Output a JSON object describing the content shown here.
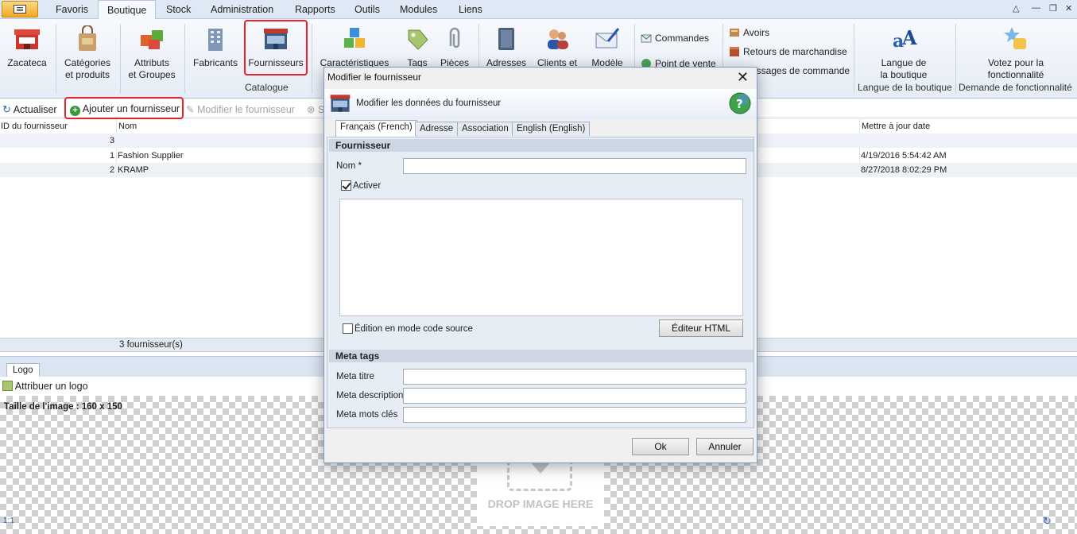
{
  "menu": {
    "tabs": [
      "Favoris",
      "Boutique",
      "Stock",
      "Administration",
      "Rapports",
      "Outils",
      "Modules",
      "Liens"
    ],
    "active_tab": "Boutique"
  },
  "ribbon": {
    "zacateca": "Zacateca",
    "categories_l1": "Catégories",
    "categories_l2": "et produits",
    "attributs_l1": "Attributs",
    "attributs_l2": "et Groupes",
    "fabricants": "Fabricants",
    "fournisseurs": "Fournisseurs",
    "catalogue_group": "Catalogue",
    "caracteristiques": "Caractéristiques",
    "tags": "Tags",
    "pieces": "Pièces",
    "adresses": "Adresses",
    "clients": "Clients et",
    "modele": "Modèle",
    "commandes": "Commandes",
    "point_de_vente": "Point de vente",
    "avoirs": "Avoirs",
    "retours": "Retours de marchandise",
    "messages": "Messages de commande",
    "langue_l1": "Langue de",
    "langue_l2": "la boutique",
    "langue_group": "Langue de la boutique",
    "votez_l1": "Votez pour la",
    "votez_l2": "fonctionnalité",
    "demande_group": "Demande de fonctionnalité"
  },
  "toolbar": {
    "refresh": "Actualiser",
    "add": "Ajouter un fournisseur",
    "edit": "Modifier le fournisseur",
    "delete_partial": "S"
  },
  "grid": {
    "columns": [
      "ID du fournisseur",
      "Nom",
      "Mettre à jour date"
    ],
    "rows": [
      {
        "id": "3",
        "name": "",
        "date": ""
      },
      {
        "id": "1",
        "name": "Fashion Supplier",
        "date": "4/19/2016 5:54:42 AM"
      },
      {
        "id": "2",
        "name": "KRAMP",
        "date": "8/27/2018 8:02:29 PM"
      }
    ],
    "footer": "3 fournisseur(s)"
  },
  "logo": {
    "tab": "Logo",
    "assign": "Attribuer un logo",
    "size": "Taille de l'image : 160 x 150",
    "drop": "DROP IMAGE HERE"
  },
  "dialog": {
    "title": "Modifier le fournisseur",
    "subtitle": "Modifier les données du fournisseur",
    "tabs": [
      "Français (French)",
      "Adresse",
      "Association",
      "English (English)"
    ],
    "section_supplier": "Fournisseur",
    "name_label": "Nom *",
    "name_value": "",
    "active_label": "Activer",
    "active_checked": true,
    "source_label": "Édition en mode code source",
    "html_editor": "Éditeur HTML",
    "section_meta": "Meta tags",
    "meta_title": "Meta titre",
    "meta_description": "Meta description",
    "meta_keywords": "Meta mots clés",
    "ok": "Ok",
    "cancel": "Annuler"
  },
  "colors": {
    "highlight": "#e8222a",
    "ribbon_bg": "#e6edf6",
    "accent": "#2a5a9e"
  }
}
